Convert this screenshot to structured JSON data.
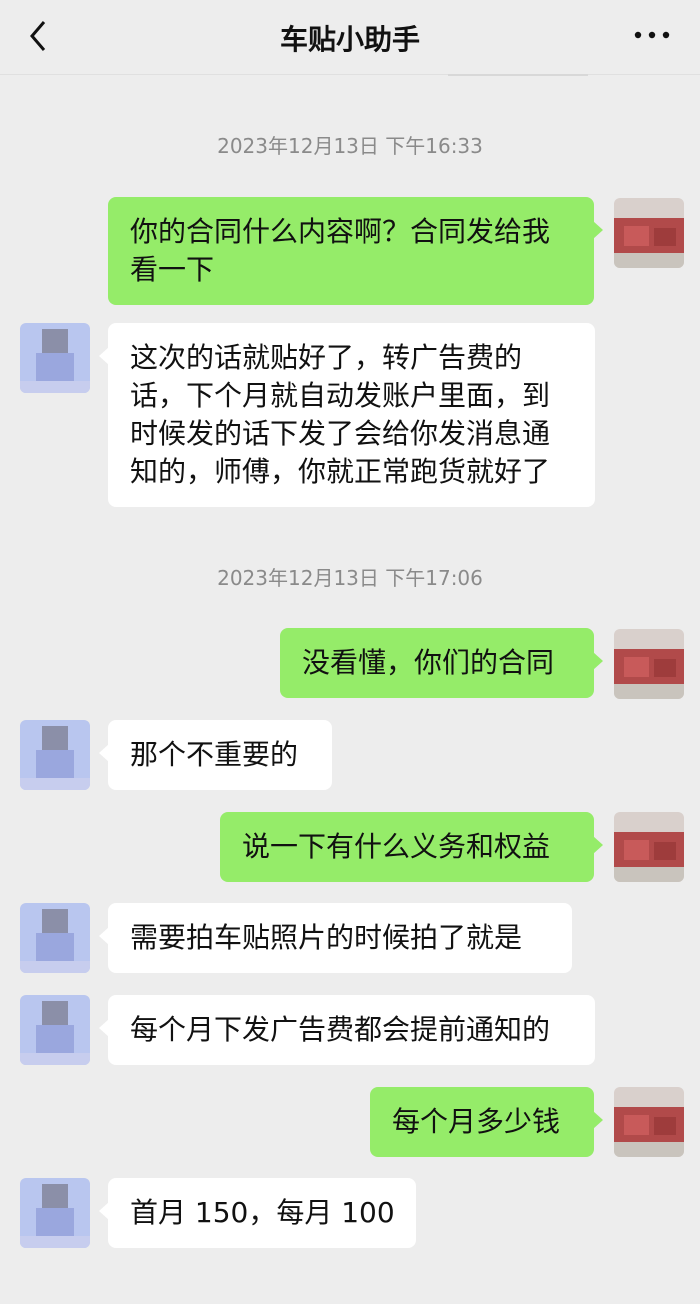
{
  "header": {
    "title": "车贴小助手",
    "back_icon": "chevron-left-icon",
    "more_icon": "more-dots-icon"
  },
  "timestamps": [
    "2023年12月13日 下午16:33",
    "2023年12月13日 下午17:06"
  ],
  "messages": [
    {
      "sender": "me",
      "text": "你的合同什么内容啊？合同发给我看一下"
    },
    {
      "sender": "other",
      "text": "这次的话就贴好了，转广告费的话，下个月就自动发账户里面，到时候发的话下发了会给你发消息通知的，师傅，你就正常跑货就好了"
    },
    {
      "sender": "me",
      "text": "没看懂，你们的合同"
    },
    {
      "sender": "other",
      "text": "那个不重要的"
    },
    {
      "sender": "me",
      "text": "说一下有什么义务和权益"
    },
    {
      "sender": "other",
      "text": "需要拍车贴照片的时候拍了就是"
    },
    {
      "sender": "other",
      "text": "每个月下发广告费都会提前通知的"
    },
    {
      "sender": "me",
      "text": "每个月多少钱"
    },
    {
      "sender": "other",
      "text": "首月 150，每月 100"
    }
  ],
  "colors": {
    "background": "#ededed",
    "my_bubble": "#95ec69",
    "other_bubble": "#ffffff",
    "timestamp": "#8a8a8a"
  }
}
